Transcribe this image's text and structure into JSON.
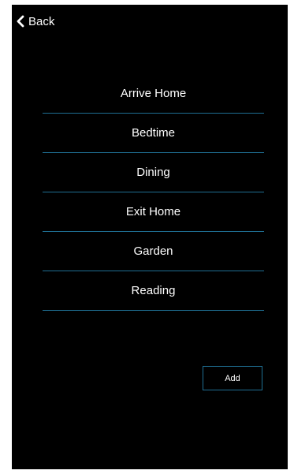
{
  "nav": {
    "back_label": "Back",
    "back_icon": "chevron-left-icon"
  },
  "scenes": [
    {
      "label": "Arrive Home"
    },
    {
      "label": "Bedtime"
    },
    {
      "label": "Dining"
    },
    {
      "label": "Exit Home"
    },
    {
      "label": "Garden"
    },
    {
      "label": "Reading"
    }
  ],
  "actions": {
    "add_label": "Add"
  },
  "colors": {
    "background": "#000000",
    "text": "#ffffff",
    "accent": "#1f6f93"
  }
}
